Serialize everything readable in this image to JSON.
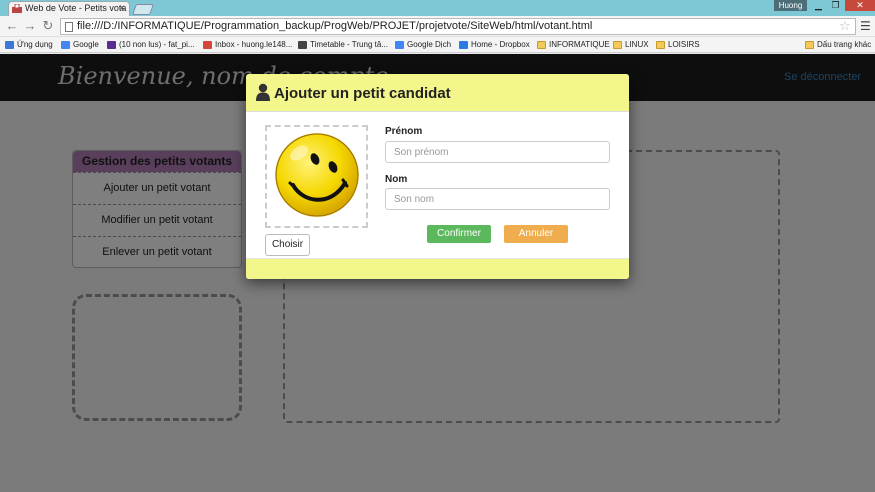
{
  "browser": {
    "tab_title": "Web de Vote - Petits vota",
    "tab_close": "×",
    "user": "Huong",
    "url": "file:///D:/INFORMATIQUE/Programmation_backup/ProgWeb/PROJET/projetvote/SiteWeb/html/votant.html",
    "bookmarks": [
      {
        "label": "Ứng dụng",
        "icon": "apps-icon",
        "color": "#3c78d8"
      },
      {
        "label": "Google",
        "icon": "google-icon",
        "color": "#4285f4"
      },
      {
        "label": "(10 non lus) - fat_pi...",
        "icon": "yahoo-mail-icon",
        "color": "#5b2d90"
      },
      {
        "label": "Inbox - huong.le148...",
        "icon": "gmail-icon",
        "color": "#d44638"
      },
      {
        "label": "Timetable - Trung tâ...",
        "icon": "timetable-icon",
        "color": "#444444"
      },
      {
        "label": "Google Dịch",
        "icon": "translate-icon",
        "color": "#4285f4"
      },
      {
        "label": "Home - Dropbox",
        "icon": "dropbox-icon",
        "color": "#2c7be5"
      },
      {
        "label": "INFORMATIQUE",
        "icon": "folder-icon",
        "color": "#f5c85a"
      },
      {
        "label": "LINUX",
        "icon": "folder-icon",
        "color": "#f5c85a"
      },
      {
        "label": "LOISIRS",
        "icon": "folder-icon",
        "color": "#f5c85a"
      }
    ],
    "other_bookmarks": "Dấu trang khác"
  },
  "site": {
    "welcome": "Bienvenue, nom de compte",
    "logout": "Se déconnecter",
    "panel_title": "Gestion des petits votants",
    "panel_items": [
      "Ajouter un petit votant",
      "Modifier un petit votant",
      "Enlever un petit votant"
    ]
  },
  "modal": {
    "title": "Ajouter un petit candidat",
    "choose_label": "Choisir",
    "firstname_label": "Prénom",
    "firstname_placeholder": "Son prénom",
    "lastname_label": "Nom",
    "lastname_placeholder": "Son nom",
    "confirm_label": "Confirmer",
    "cancel_label": "Annuler"
  },
  "colors": {
    "modal_header": "#f3f68a",
    "panel_header": "#b37fb8",
    "confirm": "#5cb85c",
    "cancel": "#f0ad4e",
    "link": "#3a86c6"
  }
}
